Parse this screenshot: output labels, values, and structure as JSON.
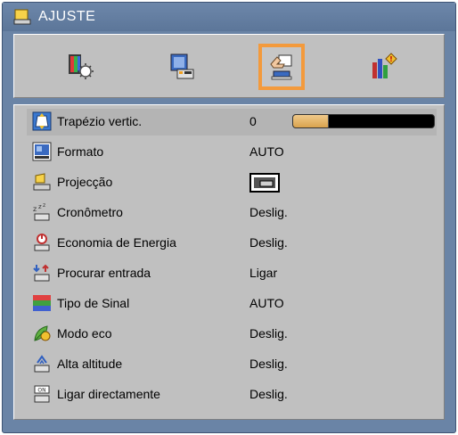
{
  "title": "AJUSTE",
  "tabs": [
    {
      "name": "image-settings-tab",
      "icon": "image-settings-icon",
      "selected": false
    },
    {
      "name": "display-settings-tab",
      "icon": "display-settings-icon",
      "selected": false
    },
    {
      "name": "setup-tab",
      "icon": "setup-hand-icon",
      "selected": true
    },
    {
      "name": "options-tab",
      "icon": "options-icon",
      "selected": false
    }
  ],
  "menu": {
    "keystone": {
      "label": "Trapézio vertic.",
      "value": "0",
      "level": 0.25
    },
    "format": {
      "label": "Formato",
      "value": "AUTO"
    },
    "projection": {
      "label": "Projecção",
      "icon": "projection-front-icon"
    },
    "timer": {
      "label": "Cronômetro",
      "value": "Deslig."
    },
    "power_saving": {
      "label": "Economia de Energia",
      "value": "Deslig."
    },
    "source_search": {
      "label": "Procurar entrada",
      "value": "Ligar"
    },
    "signal_type": {
      "label": "Tipo de Sinal",
      "value": "AUTO"
    },
    "eco_mode": {
      "label": "Modo eco",
      "value": "Deslig."
    },
    "high_altitude": {
      "label": "Alta altitude",
      "value": "Deslig."
    },
    "direct_power_on": {
      "label": "Ligar directamente",
      "value": "Deslig."
    }
  },
  "colors": {
    "frame": "#6a84a6",
    "panel": "#c0c0c0",
    "selection": "#f39a3c",
    "slider_fill": "#e0b068"
  }
}
